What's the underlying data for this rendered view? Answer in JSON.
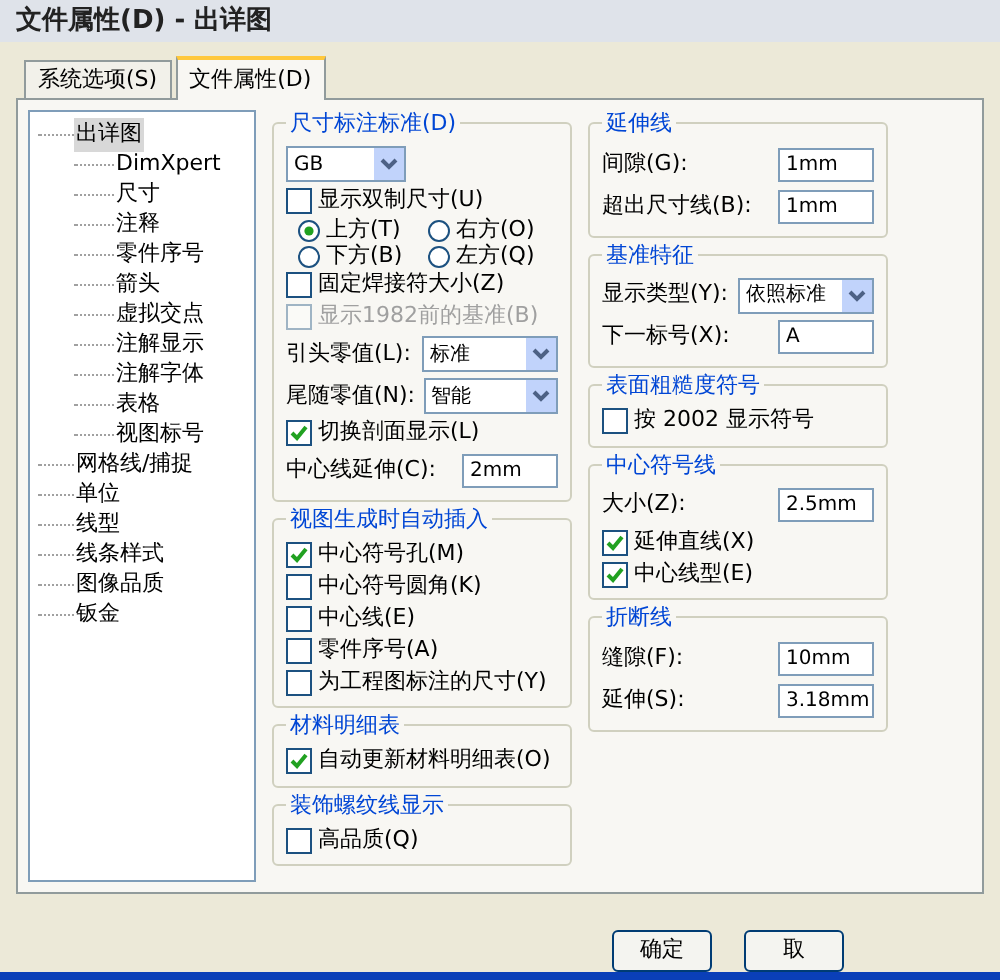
{
  "window": {
    "title": "文件属性(D) - 出详图"
  },
  "tabs": [
    {
      "label": "系统选项(S)",
      "selected": false
    },
    {
      "label": "文件属性(D)",
      "selected": true
    }
  ],
  "tree": [
    {
      "label": "出详图",
      "selected": true,
      "children": [
        {
          "label": "DimXpert",
          "selected": false
        },
        {
          "label": "尺寸",
          "selected": false
        },
        {
          "label": "注释",
          "selected": false
        },
        {
          "label": "零件序号",
          "selected": false
        },
        {
          "label": "箭头",
          "selected": false
        },
        {
          "label": "虚拟交点",
          "selected": false
        },
        {
          "label": "注解显示",
          "selected": false
        },
        {
          "label": "注解字体",
          "selected": false
        },
        {
          "label": "表格",
          "selected": false
        },
        {
          "label": "视图标号",
          "selected": false
        }
      ]
    },
    {
      "label": "网格线/捕捉",
      "selected": false
    },
    {
      "label": "单位",
      "selected": false
    },
    {
      "label": "线型",
      "selected": false
    },
    {
      "label": "线条样式",
      "selected": false
    },
    {
      "label": "图像品质",
      "selected": false
    },
    {
      "label": "钣金",
      "selected": false
    }
  ],
  "left_groups": [
    {
      "title": "尺寸标注标准(D)",
      "items": [
        {
          "kind": "select",
          "value": "GB"
        },
        {
          "kind": "checkbox",
          "label": "显示双制尺寸(U)",
          "checked": false,
          "disabled": false
        },
        {
          "kind": "radios",
          "options": [
            {
              "label": "上方(T)",
              "selected": true
            },
            {
              "label": "右方(O)",
              "selected": false
            },
            {
              "label": "下方(B)",
              "selected": false
            },
            {
              "label": "左方(Q)",
              "selected": false
            }
          ]
        },
        {
          "kind": "checkbox",
          "label": "固定焊接符大小(Z)",
          "checked": false,
          "disabled": false
        },
        {
          "kind": "checkbox",
          "label": "显示1982前的基准(B)",
          "checked": false,
          "disabled": true
        },
        {
          "kind": "select",
          "label": "引头零值(L):",
          "value": "标准"
        },
        {
          "kind": "select",
          "label": "尾随零值(N):",
          "value": "智能"
        },
        {
          "kind": "checkbox",
          "label": "切换剖面显示(L)",
          "checked": true,
          "disabled": false
        },
        {
          "kind": "field",
          "label": "中心线延伸(C):",
          "value": "2mm"
        }
      ]
    },
    {
      "title": "视图生成时自动插入",
      "items": [
        {
          "kind": "checkbox",
          "label": "中心符号孔(M)",
          "checked": true,
          "disabled": false
        },
        {
          "kind": "checkbox",
          "label": "中心符号圆角(K)",
          "checked": false,
          "disabled": false
        },
        {
          "kind": "checkbox",
          "label": "中心线(E)",
          "checked": false,
          "disabled": false
        },
        {
          "kind": "checkbox",
          "label": "零件序号(A)",
          "checked": false,
          "disabled": false
        },
        {
          "kind": "checkbox",
          "label": "为工程图标注的尺寸(Y)",
          "checked": false,
          "disabled": false
        }
      ]
    },
    {
      "title": "材料明细表",
      "items": [
        {
          "kind": "checkbox",
          "label": "自动更新材料明细表(O)",
          "checked": true,
          "disabled": false
        }
      ]
    },
    {
      "title": "装饰螺纹线显示",
      "items": [
        {
          "kind": "checkbox",
          "label": "高品质(Q)",
          "checked": false,
          "disabled": false
        }
      ]
    }
  ],
  "right_groups": [
    {
      "title": "延伸线",
      "items": [
        {
          "kind": "field",
          "label": "间隙(G):",
          "value": "1mm"
        },
        {
          "kind": "field",
          "label": "超出尺寸线(B):",
          "value": "1mm"
        }
      ]
    },
    {
      "title": "基准特征",
      "items": [
        {
          "kind": "select",
          "label": "显示类型(Y):",
          "value": "依照标准"
        },
        {
          "kind": "field",
          "label": "下一标号(X):",
          "value": "A"
        }
      ]
    },
    {
      "title": "表面粗糙度符号",
      "items": [
        {
          "kind": "checkbox",
          "label": "按 2002 显示符号",
          "checked": false,
          "disabled": false
        }
      ]
    },
    {
      "title": "中心符号线",
      "items": [
        {
          "kind": "field",
          "label": "大小(Z):",
          "value": "2.5mm"
        },
        {
          "kind": "checkbox",
          "label": "延伸直线(X)",
          "checked": true,
          "disabled": false
        },
        {
          "kind": "checkbox",
          "label": "中心线型(E)",
          "checked": true,
          "disabled": false
        }
      ]
    },
    {
      "title": "折断线",
      "items": [
        {
          "kind": "field",
          "label": "缝隙(F):",
          "value": "10mm"
        },
        {
          "kind": "field",
          "label": "延伸(S):",
          "value": "3.18mm"
        }
      ]
    }
  ],
  "buttons": [
    "确定",
    "取"
  ]
}
